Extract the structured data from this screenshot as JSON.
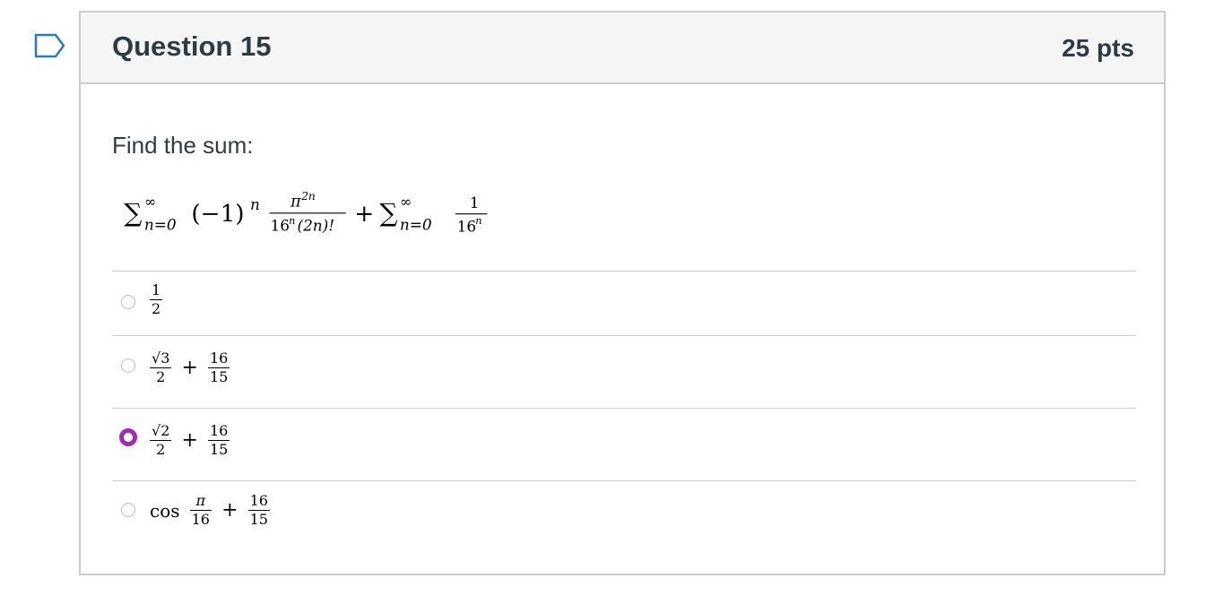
{
  "question": {
    "title": "Question 15",
    "points": "25 pts",
    "prompt": "Find the sum:",
    "formula": {
      "sum1": "∑",
      "sup1": "∞",
      "sub1": "n=0",
      "term1": "(−1)",
      "term1_exp": "n",
      "frac1_num": "π",
      "frac1_num_exp": "2n",
      "frac1_den_a": "16",
      "frac1_den_a_exp": "n",
      "frac1_den_b": "(2n)!",
      "plus": "+",
      "sum2": "∑",
      "sup2": "∞",
      "sub2": "n=0",
      "frac2_num": "1",
      "frac2_den": "16",
      "frac2_den_exp": "n"
    }
  },
  "answers": [
    {
      "selected": false,
      "num": "1",
      "den": "2"
    },
    {
      "selected": false,
      "num1": "√3",
      "den1": "2",
      "plus": "+",
      "num2": "16",
      "den2": "15"
    },
    {
      "selected": true,
      "num1": "√2",
      "den1": "2",
      "plus": "+",
      "num2": "16",
      "den2": "15"
    },
    {
      "selected": false,
      "fn": "cos",
      "num1": "π",
      "den1": "16",
      "plus": "+",
      "num2": "16",
      "den2": "15"
    }
  ],
  "colors": {
    "selected_radio": "#9b2fae",
    "flag_outline": "#2b7abc",
    "border": "#c7cdd1"
  },
  "icons": {
    "flag": "bookmark-flag-icon"
  }
}
